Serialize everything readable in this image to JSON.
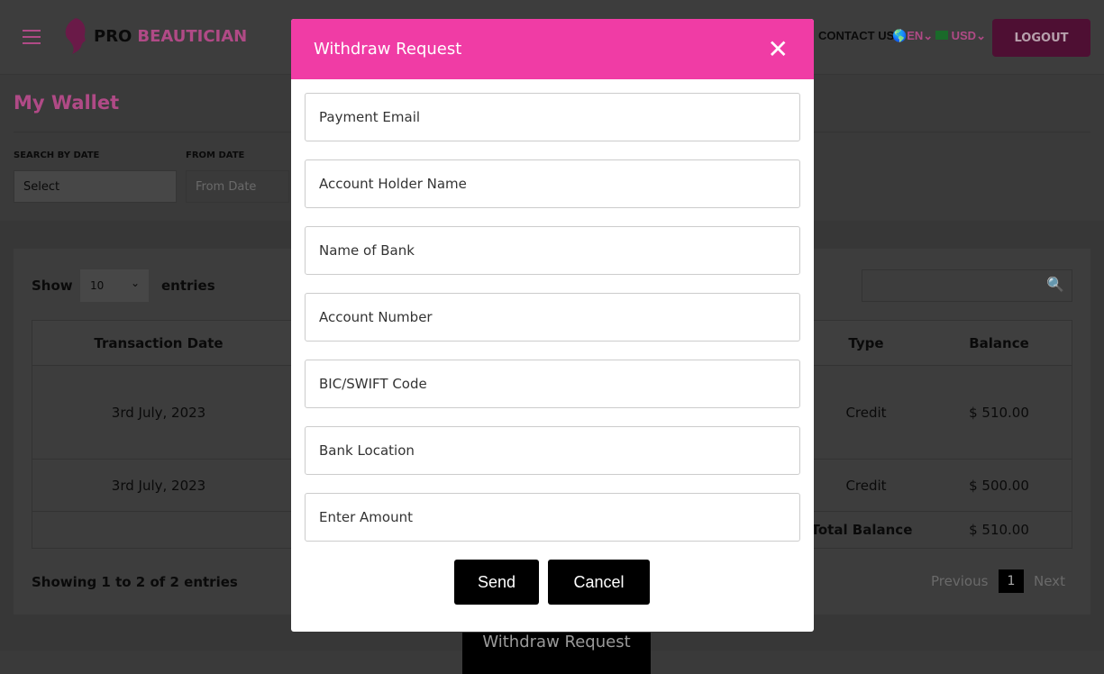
{
  "header": {
    "brand_pro": "PRO",
    "brand_name": "BEAUTICIAN",
    "contact": "CONTACT US",
    "language": "EN",
    "currency": "USD",
    "logout": "LOGOUT"
  },
  "page": {
    "title": "My Wallet",
    "search_by_date_label": "SEARCH BY DATE",
    "search_by_date_value": "Select",
    "from_date_label": "FROM DATE",
    "from_date_placeholder": "From Date"
  },
  "table": {
    "show": "Show",
    "entries_value": "10",
    "entries": "entries",
    "columns": {
      "date": "Transaction Date",
      "type": "Type",
      "balance": "Balance"
    },
    "rows": [
      {
        "date": "3rd July, 2023",
        "type": "Credit",
        "balance": "$ 510.00"
      },
      {
        "date": "3rd July, 2023",
        "type": "Credit",
        "balance": "$ 500.00"
      }
    ],
    "total_label": "Total Balance",
    "total_value": "$ 510.00",
    "info": "Showing 1 to 2 of 2 entries",
    "previous": "Previous",
    "page": "1",
    "next": "Next"
  },
  "withdraw_button": "Withdraw Request",
  "modal": {
    "title": "Withdraw Request",
    "fields": [
      "Payment Email",
      "Account Holder Name",
      "Name of Bank",
      "Account Number",
      "BIC/SWIFT Code",
      "Bank Location",
      "Enter Amount"
    ],
    "send": "Send",
    "cancel": "Cancel"
  },
  "colors": {
    "brand": "#8a1a5c",
    "modal_header": "#f03ca5"
  }
}
